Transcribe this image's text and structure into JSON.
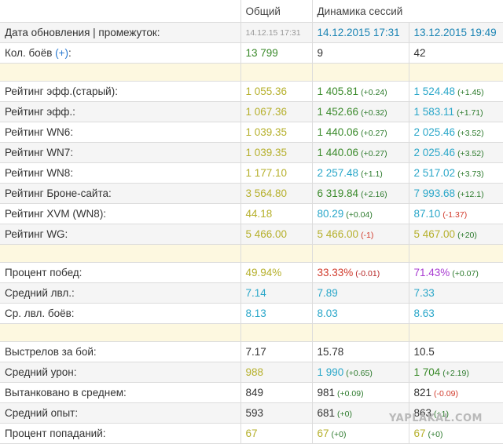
{
  "header": {
    "col_general": "Общий",
    "col_dynamics": "Динамика сессий"
  },
  "rows": {
    "update": {
      "label": "Дата обновления | промежуток:",
      "general": "14.12.15 17:31",
      "s1": "14.12.2015 17:31",
      "s2": "13.12.2015 19:49"
    },
    "battles": {
      "label": "Кол. боёв",
      "plus": "(+)",
      "label_end": ":",
      "general": "13 799",
      "s1": "9",
      "s2": "42"
    },
    "eff_old": {
      "label": "Рейтинг эфф.(старый):",
      "general": "1 055.36",
      "s1": "1 405.81",
      "s1_delta": "(+0.24)",
      "s2": "1 524.48",
      "s2_delta": "(+1.45)"
    },
    "eff": {
      "label": "Рейтинг эфф.:",
      "general": "1 067.36",
      "s1": "1 452.66",
      "s1_delta": "(+0.32)",
      "s2": "1 583.11",
      "s2_delta": "(+1.71)"
    },
    "wn6": {
      "label": "Рейтинг WN6:",
      "general": "1 039.35",
      "s1": "1 440.06",
      "s1_delta": "(+0.27)",
      "s2": "2 025.46",
      "s2_delta": "(+3.52)"
    },
    "wn7": {
      "label": "Рейтинг WN7:",
      "general": "1 039.35",
      "s1": "1 440.06",
      "s1_delta": "(+0.27)",
      "s2": "2 025.46",
      "s2_delta": "(+3.52)"
    },
    "wn8": {
      "label": "Рейтинг WN8:",
      "general": "1 177.10",
      "s1": "2 257.48",
      "s1_delta": "(+1.1)",
      "s2": "2 517.02",
      "s2_delta": "(+3.73)"
    },
    "bronesite": {
      "label": "Рейтинг Броне-сайта:",
      "general": "3 564.80",
      "s1": "6 319.84",
      "s1_delta": "(+2.16)",
      "s2": "7 993.68",
      "s2_delta": "(+12.1)"
    },
    "xvm": {
      "label": "Рейтинг XVM (WN8):",
      "general": "44.18",
      "s1": "80.29",
      "s1_delta": "(+0.04)",
      "s2": "87.10",
      "s2_delta": "(-1.37)"
    },
    "wg": {
      "label": "Рейтинг WG:",
      "general": "5 466.00",
      "s1": "5 466.00",
      "s1_delta": "(-1)",
      "s2": "5 467.00",
      "s2_delta": "(+20)"
    },
    "winrate": {
      "label": "Процент побед:",
      "general": "49.94%",
      "s1": "33.33%",
      "s1_delta": "(-0.01)",
      "s2": "71.43%",
      "s2_delta": "(+0.07)"
    },
    "avg_lvl": {
      "label": "Средний лвл.:",
      "general": "7.14",
      "s1": "7.89",
      "s2": "7.33"
    },
    "avg_battle_lvl": {
      "label": "Ср. лвл. боёв:",
      "general": "8.13",
      "s1": "8.03",
      "s2": "8.63"
    },
    "shots": {
      "label": "Выстрелов за бой:",
      "general": "7.17",
      "s1": "15.78",
      "s2": "10.5"
    },
    "avg_damage": {
      "label": "Средний урон:",
      "general": "988",
      "s1": "1 990",
      "s1_delta": "(+0.65)",
      "s2": "1 704",
      "s2_delta": "(+2.19)"
    },
    "tanked": {
      "label": "Вытанковано в среднем:",
      "general": "849",
      "s1": "981",
      "s1_delta": "(+0.09)",
      "s2": "821",
      "s2_delta": "(-0.09)"
    },
    "avg_xp": {
      "label": "Средний опыт:",
      "general": "593",
      "s1": "681",
      "s1_delta": "(+0)",
      "s2": "863",
      "s2_delta": "(+1)"
    },
    "hit_pct": {
      "label": "Процент попаданий:",
      "general": "67",
      "s1": "67",
      "s1_delta": "(+0)",
      "s2": "67",
      "s2_delta": "(+0)"
    }
  },
  "watermark": "YAPLAKAL.COM",
  "colors": {
    "separator_bg": "#fdf8e0",
    "alt_row_bg": "#f5f5f5",
    "border": "#dcdcdc",
    "yellow_value": "#b6b02c",
    "green_value": "#3a8a2a",
    "blue_value": "#2aa7c9",
    "red_delta": "#d13b2c",
    "purple_value": "#a83bd1"
  }
}
